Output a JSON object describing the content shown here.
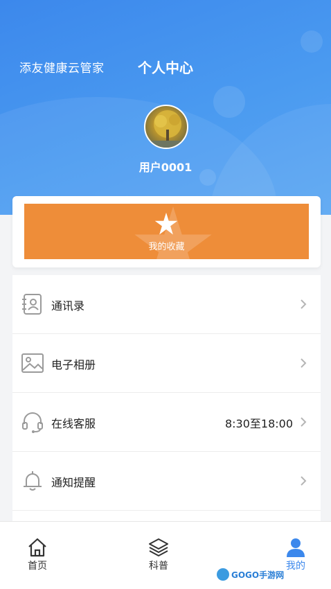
{
  "header": {
    "app_name": "添友健康云管家",
    "title": "个人中心",
    "username": "用户0001"
  },
  "favorites": {
    "label": "我的收藏",
    "color": "#ee8d39"
  },
  "menu": {
    "items": [
      {
        "label": "通讯录",
        "icon": "contacts-icon",
        "extra": ""
      },
      {
        "label": "电子相册",
        "icon": "photo-album-icon",
        "extra": ""
      },
      {
        "label": "在线客服",
        "icon": "headset-icon",
        "extra": "8:30至18:00"
      },
      {
        "label": "通知提醒",
        "icon": "bell-icon",
        "extra": ""
      }
    ]
  },
  "tabbar": {
    "tabs": [
      {
        "label": "首页",
        "icon": "home-icon",
        "active": false
      },
      {
        "label": "科普",
        "icon": "layers-icon",
        "active": false
      },
      {
        "label": "我的",
        "icon": "user-icon",
        "active": true
      }
    ]
  },
  "watermark": {
    "text": "GOGO手游网"
  },
  "colors": {
    "accent": "#3c88ec",
    "header_gradient_start": "#3c88ec",
    "header_gradient_end": "#5aa6f3",
    "favorites": "#ee8d39"
  }
}
